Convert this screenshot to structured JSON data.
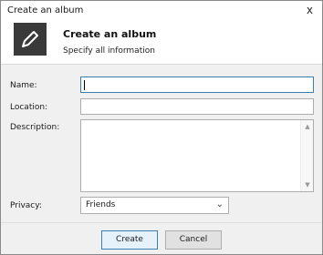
{
  "window": {
    "title": "Create an album",
    "close_glyph": "x"
  },
  "header": {
    "icon": "pencil-icon",
    "title": "Create an album",
    "subtitle": "Specify all information"
  },
  "form": {
    "name_label": "Name:",
    "name_value": "",
    "location_label": "Location:",
    "location_value": "",
    "description_label": "Description:",
    "description_value": "",
    "privacy_label": "Privacy:",
    "privacy_value": "Friends"
  },
  "buttons": {
    "create": "Create",
    "cancel": "Cancel"
  },
  "colors": {
    "accent_border": "#3c7fb1",
    "header_icon_bg": "#3a3a3a"
  }
}
